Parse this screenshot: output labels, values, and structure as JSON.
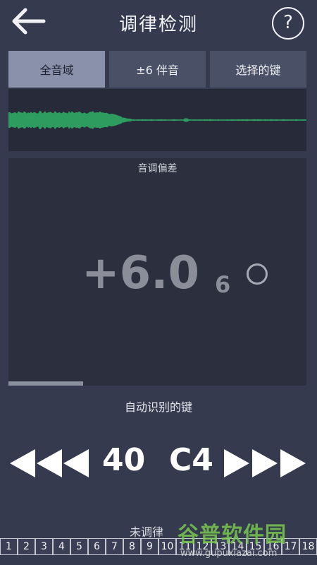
{
  "header": {
    "title": "调律检测",
    "back_icon": "back-arrow-icon",
    "help_label": "?"
  },
  "tabs": [
    {
      "label": "全音域",
      "active": true
    },
    {
      "label": "±6 伴音",
      "active": false
    },
    {
      "label": "选择的键",
      "active": false
    }
  ],
  "waveform": {
    "color": "#2e9b5f"
  },
  "panel": {
    "label": "音调偏差",
    "deviation_value": "+6.0",
    "deviation_sub": "6",
    "progress_fraction": 0.25
  },
  "auto_detect_label": "自动识别的键",
  "key": {
    "number": "40",
    "name": "C4",
    "prev_icon": "triple-left-arrow-icon",
    "next_icon": "triple-right-arrow-icon"
  },
  "untuned_label": "未调律",
  "key_strip": [
    "1",
    "2",
    "3",
    "4",
    "5",
    "6",
    "7",
    "8",
    "9",
    "10",
    "11",
    "12",
    "13",
    "14",
    "15",
    "16",
    "17",
    "18"
  ],
  "watermark": {
    "main": "谷普软件园",
    "url": "www.gupuxiazai.com"
  }
}
